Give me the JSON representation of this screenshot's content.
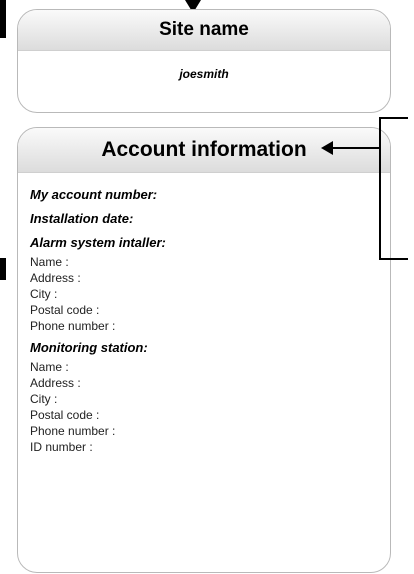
{
  "site_panel": {
    "title": "Site name",
    "value": "joesmith"
  },
  "account_panel": {
    "title": "Account information",
    "my_account_number": "My account number:",
    "installation_date": "Installation date:",
    "installer": {
      "title": "Alarm system intaller:",
      "fields": [
        "Name :",
        "Address :",
        "City :",
        "Postal code :",
        "Phone number :"
      ]
    },
    "monitoring": {
      "title": "Monitoring station:",
      "fields": [
        "Name :",
        "Address :",
        "City :",
        "Postal code :",
        "Phone number :",
        "ID number :"
      ]
    }
  }
}
